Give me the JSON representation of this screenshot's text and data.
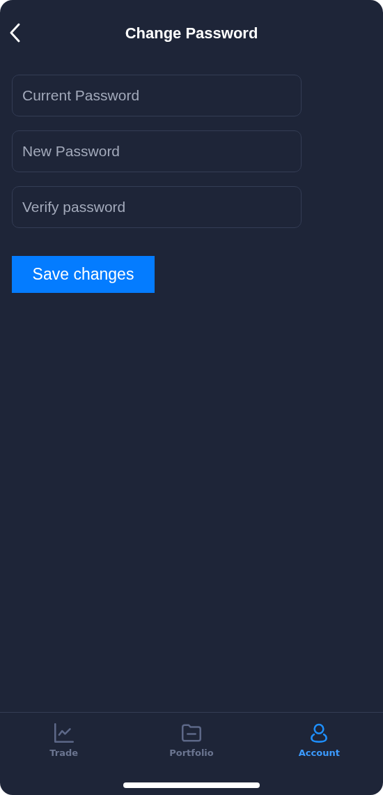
{
  "header": {
    "title": "Change Password"
  },
  "fields": [
    {
      "placeholder": "Current Password"
    },
    {
      "placeholder": "New Password"
    },
    {
      "placeholder": "Verify password"
    }
  ],
  "save_button": {
    "label": "Save changes"
  },
  "tab_bar": [
    {
      "label": "Trade",
      "kind": "chart",
      "selected": false
    },
    {
      "label": "Portfolio",
      "kind": "folder",
      "selected": false
    },
    {
      "label": "Account",
      "kind": "person",
      "selected": true
    }
  ]
}
